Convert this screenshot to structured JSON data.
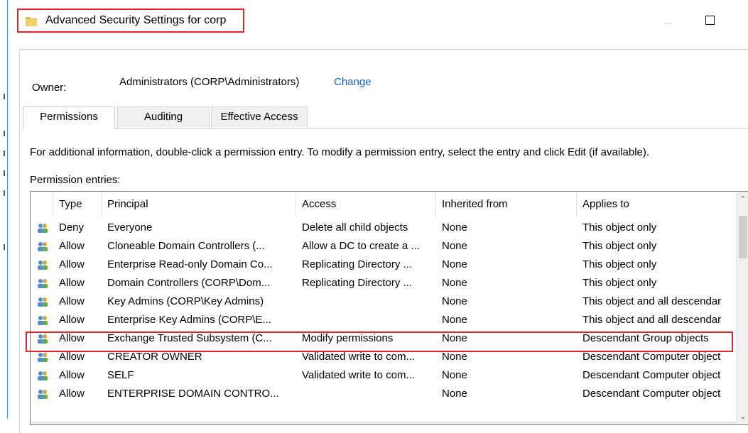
{
  "window": {
    "title": "Advanced Security Settings for corp",
    "icon": "folder-icon",
    "controls": [
      "minimize",
      "maximize"
    ]
  },
  "owner": {
    "label": "Owner:",
    "value": "Administrators (CORP\\Administrators)",
    "change_label": "Change"
  },
  "tabs": [
    {
      "label": "Permissions",
      "active": true
    },
    {
      "label": "Auditing",
      "active": false
    },
    {
      "label": "Effective Access",
      "active": false
    }
  ],
  "info_text": "For additional information, double-click a permission entry. To modify a permission entry, select the entry and click Edit (if available).",
  "entries_label": "Permission entries:",
  "columns": [
    "Type",
    "Principal",
    "Access",
    "Inherited from",
    "Applies to"
  ],
  "rows": [
    {
      "type": "Deny",
      "principal": "Everyone",
      "access": "Delete all child objects",
      "inherited": "None",
      "applies": "This object only"
    },
    {
      "type": "Allow",
      "principal": "Cloneable Domain Controllers (...",
      "access": "Allow a DC to create a ...",
      "inherited": "None",
      "applies": "This object only"
    },
    {
      "type": "Allow",
      "principal": "Enterprise Read-only Domain Co...",
      "access": "Replicating Directory ...",
      "inherited": "None",
      "applies": "This object only"
    },
    {
      "type": "Allow",
      "principal": "Domain Controllers (CORP\\Dom...",
      "access": "Replicating Directory ...",
      "inherited": "None",
      "applies": "This object only"
    },
    {
      "type": "Allow",
      "principal": "Key Admins (CORP\\Key Admins)",
      "access": "",
      "inherited": "None",
      "applies": "This object and all descendar"
    },
    {
      "type": "Allow",
      "principal": "Enterprise Key Admins (CORP\\E...",
      "access": "",
      "inherited": "None",
      "applies": "This object and all descendar"
    },
    {
      "type": "Allow",
      "principal": "Exchange Trusted Subsystem (C...",
      "access": "Modify permissions",
      "inherited": "None",
      "applies": "Descendant Group objects"
    },
    {
      "type": "Allow",
      "principal": "CREATOR OWNER",
      "access": "Validated write to com...",
      "inherited": "None",
      "applies": "Descendant Computer object"
    },
    {
      "type": "Allow",
      "principal": "SELF",
      "access": "Validated write to com...",
      "inherited": "None",
      "applies": "Descendant Computer object"
    },
    {
      "type": "Allow",
      "principal": "ENTERPRISE DOMAIN CONTRO...",
      "access": "",
      "inherited": "None",
      "applies": "Descendant Computer object"
    }
  ],
  "colors": {
    "highlight": "#e0252f",
    "link": "#1565c0"
  }
}
